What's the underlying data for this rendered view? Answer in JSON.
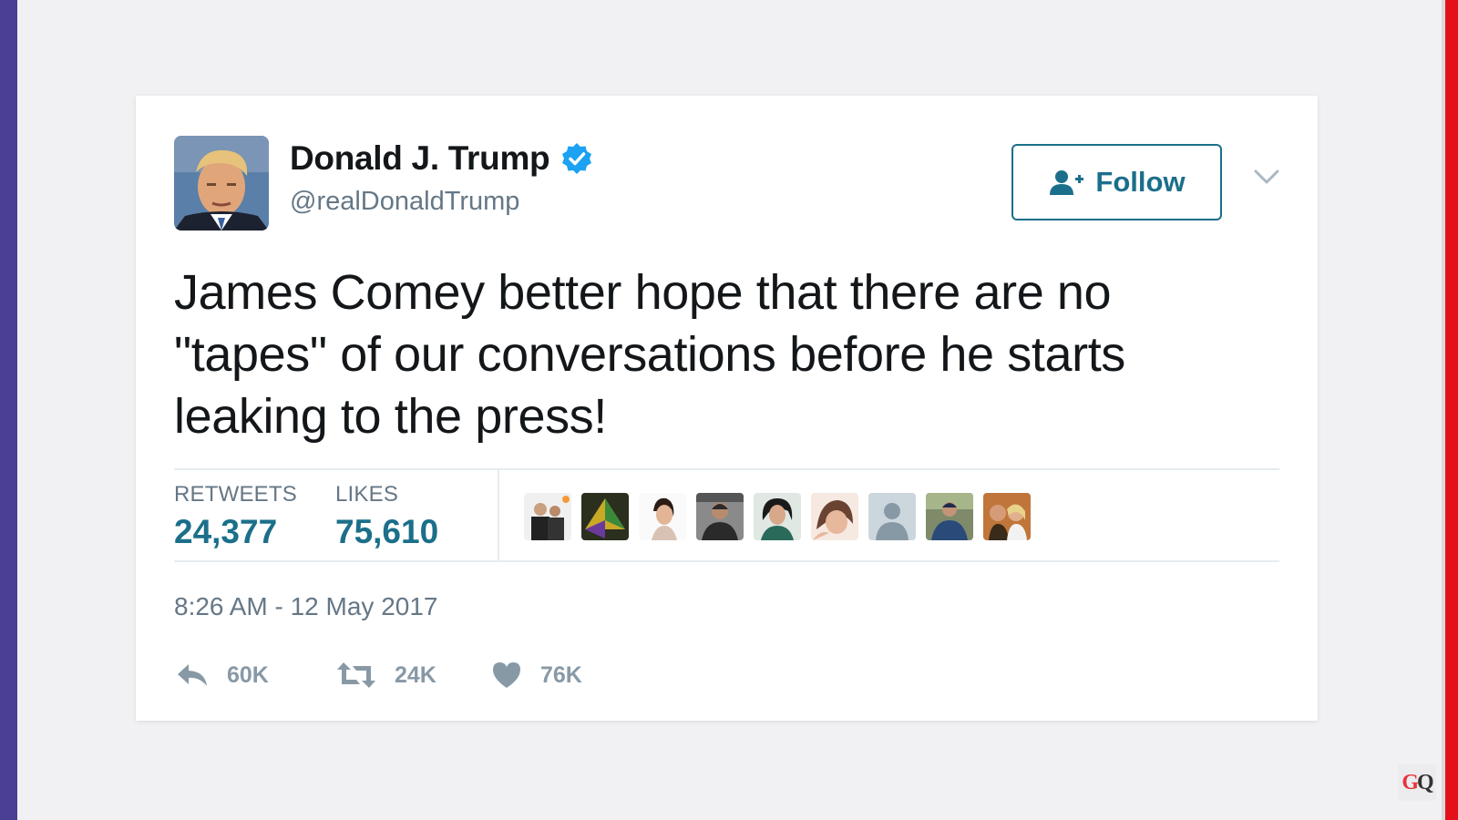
{
  "tweet": {
    "author": {
      "name": "Donald J. Trump",
      "handle": "@realDonaldTrump",
      "verified": true
    },
    "follow_label": "Follow",
    "text": "James Comey better hope that there are no \"tapes\" of our conversations before he starts leaking to the press!",
    "stats": {
      "retweets_label": "RETWEETS",
      "retweets_value": "24,377",
      "likes_label": "LIKES",
      "likes_value": "75,610"
    },
    "timestamp": "8:26 AM - 12 May 2017",
    "actions": {
      "reply_count": "60K",
      "retweet_count": "24K",
      "like_count": "76K"
    }
  },
  "colors": {
    "accent": "#1b6f8a",
    "verified_badge": "#1da1f2",
    "muted": "#657786",
    "left_bar": "#4a3f93",
    "right_bar": "#e3101c"
  },
  "watermark": {
    "g": "G",
    "q": "Q"
  }
}
